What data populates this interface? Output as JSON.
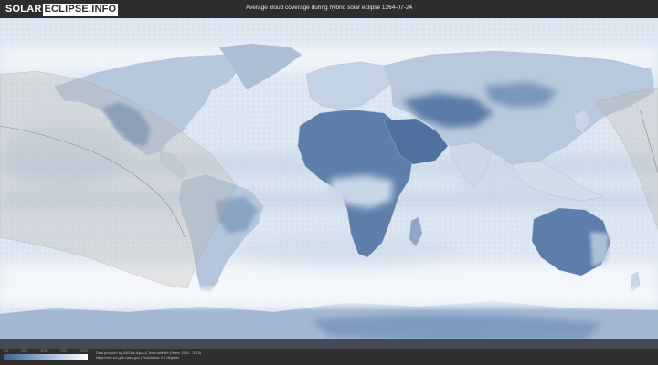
{
  "header": {
    "logo_solar": "SOLAR",
    "logo_eclipse": "ECLIPSE.INFO",
    "title": "Average cloud coverage during hybrid solar eclipse 1264-07-24"
  },
  "map": {
    "cloud_color": "#eef3f9",
    "clear_sky_color": "#4a6c9c",
    "path_shade_color": "#b8b2a8"
  },
  "footer": {
    "scale_ticks": [
      "0%",
      "25%",
      "50%",
      "75%",
      "100%"
    ],
    "credit_line1": "Data provided by NASA's Aqua & Terra satellite (Years: 2000 - 2019)",
    "credit_line2": "https://neo.sci.gsfc.nasa.gov  |  Resolution: 0.1 degrees"
  }
}
